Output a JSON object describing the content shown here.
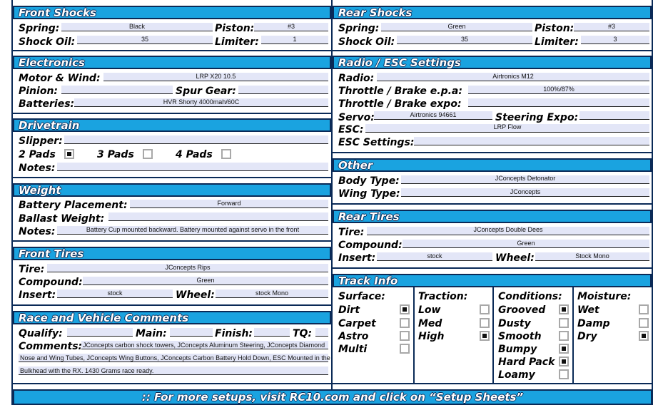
{
  "front_shocks": {
    "title": "Front Shocks",
    "spring_label": "Spring:",
    "spring": "Black",
    "piston_label": "Piston:",
    "piston": "#3",
    "oil_label": "Shock Oil:",
    "oil": "35",
    "limiter_label": "Limiter:",
    "limiter": "1"
  },
  "rear_shocks": {
    "title": "Rear Shocks",
    "spring_label": "Spring:",
    "spring": "Green",
    "piston_label": "Piston:",
    "piston": "#3",
    "oil_label": "Shock Oil:",
    "oil": "35",
    "limiter_label": "Limiter:",
    "limiter": "3"
  },
  "electronics": {
    "title": "Electronics",
    "motor_label": "Motor & Wind:",
    "motor": "LRP X20 10.5",
    "pinion_label": "Pinion:",
    "spur_label": "Spur Gear:",
    "batteries_label": "Batteries:",
    "batteries": "HVR Shorty 4000mah/60C"
  },
  "radio": {
    "title": "Radio / ESC Settings",
    "radio_label": "Radio:",
    "radio": "Airtronics M12",
    "epa_label": "Throttle / Brake e.p.a:",
    "epa": "100%/87%",
    "expo_label": "Throttle / Brake expo:",
    "servo_label": "Servo:",
    "servo": "Airtronics 94661",
    "steering_expo_label": "Steering Expo:",
    "esc_label": "ESC:",
    "esc": "LRP Flow",
    "esc_settings_label": "ESC Settings:"
  },
  "drivetrain": {
    "title": "Drivetrain",
    "slipper_label": "Slipper:",
    "pads": [
      {
        "label": "2 Pads",
        "checked": true
      },
      {
        "label": "3 Pads",
        "checked": false
      },
      {
        "label": "4 Pads",
        "checked": false
      }
    ],
    "notes_label": "Notes:"
  },
  "other": {
    "title": "Other",
    "body_label": "Body Type:",
    "body": "JConcepts Detonator",
    "wing_label": "Wing Type:",
    "wing": "JConcepts"
  },
  "weight": {
    "title": "Weight",
    "battery_label": "Battery Placement:",
    "battery": "Forward",
    "ballast_label": "Ballast Weight:",
    "notes_label": "Notes:",
    "notes": "Battery Cup mounted backward. Battery mounted against servo in the front"
  },
  "rear_tires": {
    "title": "Rear Tires",
    "tire_label": "Tire:",
    "tire": "JConcepts Double Dees",
    "compound_label": "Compound:",
    "compound": "Green",
    "insert_label": "Insert:",
    "insert": "stock",
    "wheel_label": "Wheel:",
    "wheel": "Stock Mono"
  },
  "front_tires": {
    "title": "Front Tires",
    "tire_label": "Tire:",
    "tire": "JConcepts Rips",
    "compound_label": "Compound:",
    "compound": "Green",
    "insert_label": "Insert:",
    "insert": "stock",
    "wheel_label": "Wheel:",
    "wheel": "stock Mono"
  },
  "track": {
    "title": "Track Info",
    "surface_label": "Surface:",
    "surface": [
      {
        "label": "Dirt",
        "checked": true
      },
      {
        "label": "Carpet",
        "checked": false
      },
      {
        "label": "Astro",
        "checked": false
      },
      {
        "label": "Multi",
        "checked": false
      }
    ],
    "traction_label": "Traction:",
    "traction": [
      {
        "label": "Low",
        "checked": false
      },
      {
        "label": "Med",
        "checked": false
      },
      {
        "label": "High",
        "checked": true
      }
    ],
    "conditions_label": "Conditions:",
    "conditions": [
      {
        "label": "Grooved",
        "checked": true
      },
      {
        "label": "Dusty",
        "checked": false
      },
      {
        "label": "Smooth",
        "checked": false
      },
      {
        "label": "Bumpy",
        "checked": true
      },
      {
        "label": "Hard Pack",
        "checked": true
      },
      {
        "label": "Loamy",
        "checked": false
      }
    ],
    "moisture_label": "Moisture:",
    "moisture": [
      {
        "label": "Wet",
        "checked": false
      },
      {
        "label": "Damp",
        "checked": false
      },
      {
        "label": "Dry",
        "checked": true
      }
    ]
  },
  "comments": {
    "title": "Race and Vehicle Comments",
    "qualify_label": "Qualify:",
    "main_label": "Main:",
    "finish_label": "Finish:",
    "tq_label": "TQ:",
    "comments_label": "Comments:",
    "line1": "JConcepts carbon shock towers, JConcepts Aluminum Steering, JConcepts Diamond",
    "line2": "Nose and Wing Tubes, JConcepts Wing Buttons, JConcepts Carbon Battery Hold Down, ESC Mounted in the",
    "line3": "Bulkhead with the RX. 1430 Grams race ready."
  },
  "footer": ":: For more setups, visit RC10.com and click on “Setup Sheets”"
}
